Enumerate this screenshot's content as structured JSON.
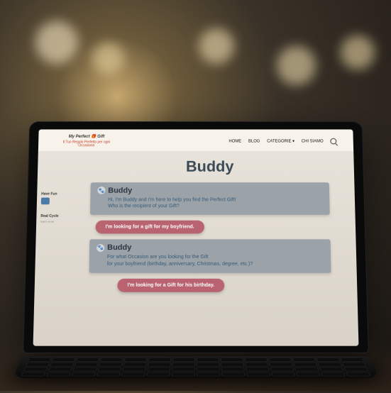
{
  "logo": {
    "line1": "My",
    "line2": "Perfect",
    "line3": "Gift",
    "tagline": "Il Tuo Regalo Perfetto per ogni Occasione"
  },
  "nav": {
    "home": "HOME",
    "blog": "BLOG",
    "categorie": "CATEGORIE ▾",
    "chisiamo": "CHI SIAMO"
  },
  "side": {
    "item1": {
      "label": "Have Fun",
      "sub": ""
    },
    "item2": {
      "label": "Real Cycle",
      "sub": "learn more"
    }
  },
  "page": {
    "title": "Buddy"
  },
  "chat": {
    "bot1": {
      "name": "Buddy",
      "text": "Hi, I'm Buddy and I'm here to help you find the Perfect Gift!\nWho is the recipient of your Gift?"
    },
    "user1": "I'm looking for a gift for my boyfriend.",
    "bot2": {
      "name": "Buddy",
      "text": "For what Occasion are you looking for the Gift\nfor your boyfriend (birthday, anniversary, Christmas, degree, etc.)?"
    },
    "user2": "I'm looking for a Gift for his birthday."
  }
}
